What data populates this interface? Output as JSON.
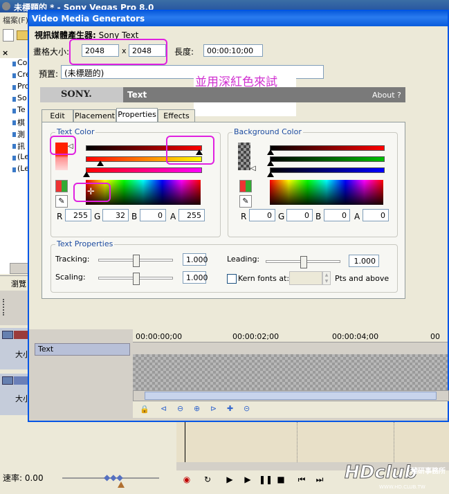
{
  "app": {
    "window_title": "未標題的 * - Sony Vegas Pro 8.0",
    "menu_first": "檔案(F)",
    "media_items": [
      "Co",
      "Cre",
      "Pro",
      "So",
      "Te",
      "棋",
      "測",
      "訊",
      "(Le",
      "(Le"
    ],
    "bottom_tab": "瀏覽",
    "track_label_1": "大小",
    "track_label_2": "大小",
    "rate_label": "速率: 0.00",
    "logo_text": "HDclub",
    "logo_sub": "精研事務所",
    "logo_url": "WWW.HD.CLUB.TW"
  },
  "dialog": {
    "title": "Video Media Generators",
    "generator_label": "視訊媒體產生器:",
    "generator_name": "Sony Text",
    "frame_size_label": "畫格大小:",
    "width": "2048",
    "x": "x",
    "height": "2048",
    "length_label": "長度:",
    "length": "00:00:10;00",
    "preset_label": "預置:",
    "preset_value": "(未標題的)",
    "annotation": "並用深紅色來試",
    "sony_logo": "SONY.",
    "sony_text": "Text",
    "about": "About ?",
    "tabs": [
      "Edit",
      "Placement",
      "Properties",
      "Effects"
    ],
    "text_color": {
      "label": "Text Color",
      "r": "255",
      "g": "32",
      "b": "0",
      "a": "255"
    },
    "bg_color": {
      "label": "Background Color",
      "r": "0",
      "g": "0",
      "b": "0",
      "a": "0"
    },
    "rgba_labels": [
      "R",
      "G",
      "B",
      "A"
    ],
    "text_props": {
      "label": "Text Properties",
      "tracking_label": "Tracking:",
      "tracking": "1.000",
      "scaling_label": "Scaling:",
      "scaling": "1.000",
      "leading_label": "Leading:",
      "leading": "1.000",
      "kern_label": "Kern fonts at:",
      "kern_suffix": "Pts and above"
    },
    "timeline": {
      "track_name": "Text",
      "t0": "00:00:00;00",
      "t1": "00:00:02;00",
      "t2": "00:00:04;00",
      "t3": "00"
    }
  },
  "colors": {
    "dialog_border": "#0055e5",
    "highlight": "#e020e0",
    "text_color_swatch": "#ff2000",
    "group_label": "#1c4ba0"
  }
}
